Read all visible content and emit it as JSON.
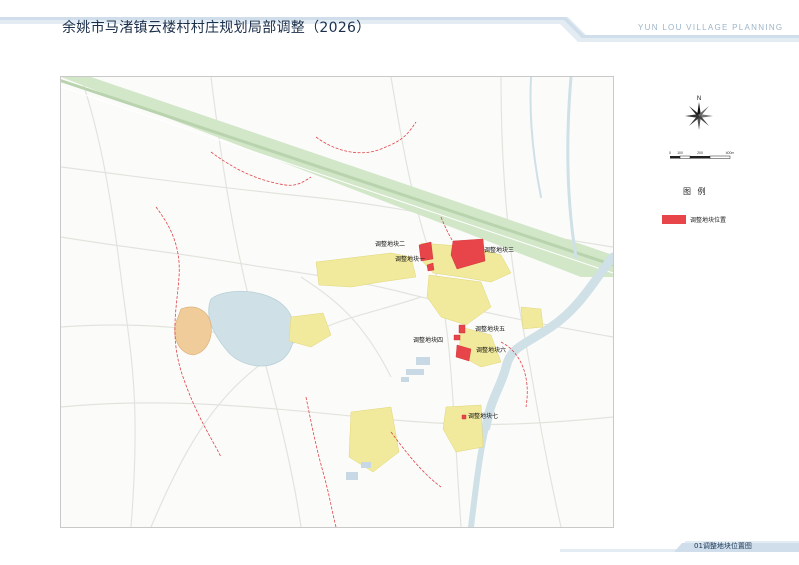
{
  "header": {
    "title": "余姚市马渚镇云楼村村庄规划局部调整（2026）",
    "brand": "YUN LOU   VILLAGE PLANNING"
  },
  "colors": {
    "highlight": "#e8454b",
    "residential": "#f1ea9c",
    "water": "#cfe0e6",
    "highway": "#cfe3c5",
    "boundary": "#e0444a",
    "header_band": "#d6e4ee"
  },
  "map": {
    "plots": [
      {
        "label": "调整地块二"
      },
      {
        "label": "调整地块三"
      },
      {
        "label": "调整地块一"
      },
      {
        "label": "调整地块五"
      },
      {
        "label": "调整地块四"
      },
      {
        "label": "调整地块六"
      },
      {
        "label": "调整地块七"
      }
    ]
  },
  "compass": {
    "north": "N"
  },
  "scalebar": {
    "ticks": [
      "0",
      "100",
      "200",
      "400m"
    ]
  },
  "legend": {
    "title": "图 例",
    "items": [
      {
        "label": "调整地块位置",
        "color": "#e8454b"
      }
    ]
  },
  "footer": {
    "caption": "01调整地块位置图"
  }
}
